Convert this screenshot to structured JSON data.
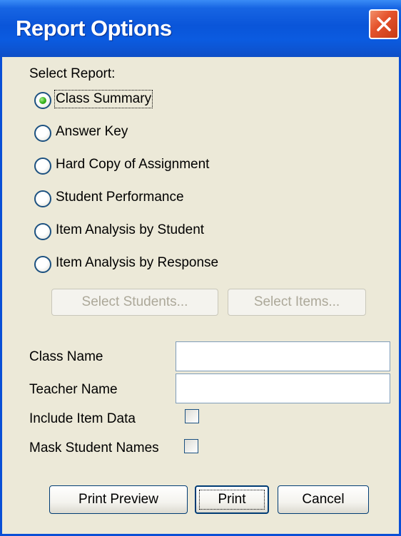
{
  "window": {
    "title": "Report Options",
    "close_icon": "close-icon"
  },
  "select_report": {
    "label": "Select Report:",
    "options": [
      {
        "label": "Class Summary",
        "selected": true
      },
      {
        "label": "Answer Key",
        "selected": false
      },
      {
        "label": "Hard Copy of Assignment",
        "selected": false
      },
      {
        "label": "Student Performance",
        "selected": false
      },
      {
        "label": "Item Analysis by Student",
        "selected": false
      },
      {
        "label": "Item Analysis by Response",
        "selected": false
      }
    ]
  },
  "selectors": {
    "students_label": "Select Students...",
    "items_label": "Select Items..."
  },
  "fields": {
    "class_name_label": "Class Name",
    "class_name_value": "",
    "teacher_name_label": "Teacher Name",
    "teacher_name_value": "",
    "include_item_data_label": "Include Item Data",
    "include_item_data_checked": false,
    "mask_student_names_label": "Mask Student Names",
    "mask_student_names_checked": false
  },
  "actions": {
    "print_preview_label": "Print Preview",
    "print_label": "Print",
    "cancel_label": "Cancel"
  },
  "colors": {
    "titlebar": "#0a55d9",
    "dialog_background": "#ece9d8",
    "close_button": "#e5542d",
    "selected_radio": "#34b11b"
  }
}
